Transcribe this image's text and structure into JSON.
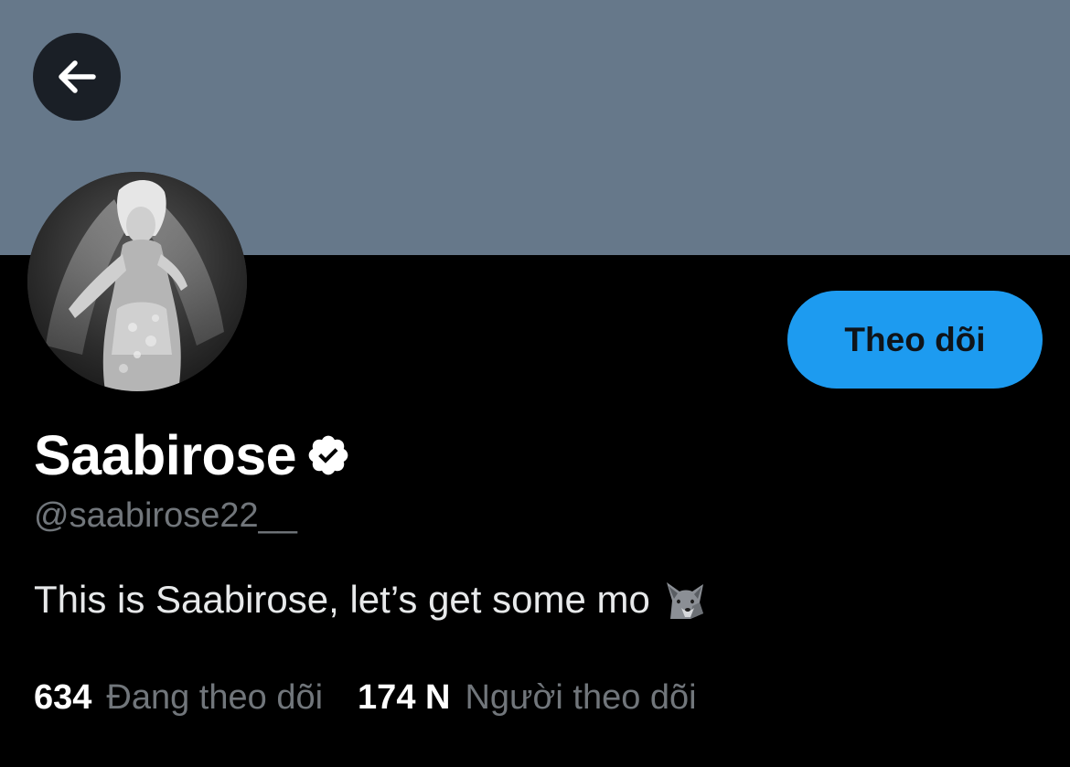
{
  "colors": {
    "banner": "#66788a",
    "background": "#000000",
    "accent": "#1d9bf0",
    "muted_text": "#71767b",
    "primary_text": "#ffffff"
  },
  "header": {
    "back_icon": "arrow-left-icon"
  },
  "profile": {
    "avatar_icon": "profile-photo",
    "follow_label": "Theo dõi",
    "display_name": "Saabirose",
    "verified_icon": "verified-badge-icon",
    "handle": "@saabirose22__",
    "bio": "This is Saabirose, let’s get some mo",
    "bio_emoji": "wolf-emoji"
  },
  "stats": {
    "following_count": "634",
    "following_label": "Đang theo dõi",
    "followers_count": "174 N",
    "followers_label": "Người theo dõi"
  }
}
